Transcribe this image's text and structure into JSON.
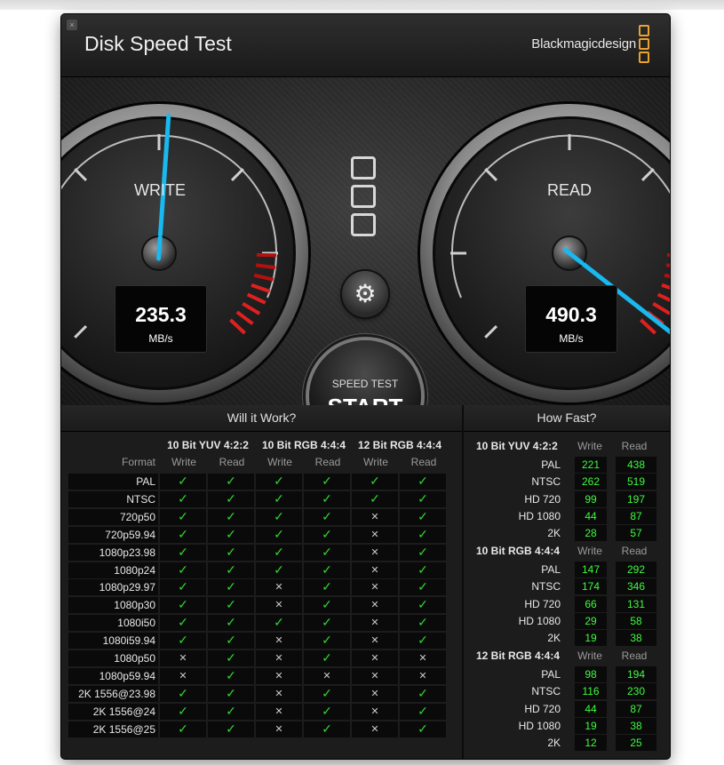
{
  "app": {
    "title": "Disk Speed Test",
    "brand": "Blackmagicdesign",
    "close": "×"
  },
  "gauges": {
    "write": {
      "label": "WRITE",
      "value": "235.3",
      "unit": "MB/s"
    },
    "read": {
      "label": "READ",
      "value": "490.3",
      "unit": "MB/s"
    }
  },
  "controls": {
    "settings_icon": "gear-icon",
    "start_small": "SPEED TEST",
    "start_big": "START"
  },
  "will_it_work": {
    "title": "Will it Work?",
    "groups": [
      "10 Bit YUV 4:2:2",
      "10 Bit RGB 4:4:4",
      "12 Bit RGB 4:4:4"
    ],
    "format_label": "Format",
    "col_labels": [
      "Write",
      "Read",
      "Write",
      "Read",
      "Write",
      "Read"
    ],
    "rows": [
      {
        "name": "PAL",
        "marks": [
          1,
          1,
          1,
          1,
          1,
          1
        ]
      },
      {
        "name": "NTSC",
        "marks": [
          1,
          1,
          1,
          1,
          1,
          1
        ]
      },
      {
        "name": "720p50",
        "marks": [
          1,
          1,
          1,
          1,
          0,
          1
        ]
      },
      {
        "name": "720p59.94",
        "marks": [
          1,
          1,
          1,
          1,
          0,
          1
        ]
      },
      {
        "name": "1080p23.98",
        "marks": [
          1,
          1,
          1,
          1,
          0,
          1
        ]
      },
      {
        "name": "1080p24",
        "marks": [
          1,
          1,
          1,
          1,
          0,
          1
        ]
      },
      {
        "name": "1080p29.97",
        "marks": [
          1,
          1,
          0,
          1,
          0,
          1
        ]
      },
      {
        "name": "1080p30",
        "marks": [
          1,
          1,
          0,
          1,
          0,
          1
        ]
      },
      {
        "name": "1080i50",
        "marks": [
          1,
          1,
          1,
          1,
          0,
          1
        ]
      },
      {
        "name": "1080i59.94",
        "marks": [
          1,
          1,
          0,
          1,
          0,
          1
        ]
      },
      {
        "name": "1080p50",
        "marks": [
          0,
          1,
          0,
          1,
          0,
          0
        ]
      },
      {
        "name": "1080p59.94",
        "marks": [
          0,
          1,
          0,
          0,
          0,
          0
        ]
      },
      {
        "name": "2K 1556@23.98",
        "marks": [
          1,
          1,
          0,
          1,
          0,
          1
        ]
      },
      {
        "name": "2K 1556@24",
        "marks": [
          1,
          1,
          0,
          1,
          0,
          1
        ]
      },
      {
        "name": "2K 1556@25",
        "marks": [
          1,
          1,
          0,
          1,
          0,
          1
        ]
      }
    ]
  },
  "how_fast": {
    "title": "How Fast?",
    "col_write": "Write",
    "col_read": "Read",
    "sections": [
      {
        "name": "10 Bit YUV 4:2:2",
        "rows": [
          {
            "name": "PAL",
            "write": "221",
            "read": "438"
          },
          {
            "name": "NTSC",
            "write": "262",
            "read": "519"
          },
          {
            "name": "HD 720",
            "write": "99",
            "read": "197"
          },
          {
            "name": "HD 1080",
            "write": "44",
            "read": "87"
          },
          {
            "name": "2K",
            "write": "28",
            "read": "57"
          }
        ]
      },
      {
        "name": "10 Bit RGB 4:4:4",
        "rows": [
          {
            "name": "PAL",
            "write": "147",
            "read": "292"
          },
          {
            "name": "NTSC",
            "write": "174",
            "read": "346"
          },
          {
            "name": "HD 720",
            "write": "66",
            "read": "131"
          },
          {
            "name": "HD 1080",
            "write": "29",
            "read": "58"
          },
          {
            "name": "2K",
            "write": "19",
            "read": "38"
          }
        ]
      },
      {
        "name": "12 Bit RGB 4:4:4",
        "rows": [
          {
            "name": "PAL",
            "write": "98",
            "read": "194"
          },
          {
            "name": "NTSC",
            "write": "116",
            "read": "230"
          },
          {
            "name": "HD 720",
            "write": "44",
            "read": "87"
          },
          {
            "name": "HD 1080",
            "write": "19",
            "read": "38"
          },
          {
            "name": "2K",
            "write": "12",
            "read": "25"
          }
        ]
      }
    ]
  }
}
